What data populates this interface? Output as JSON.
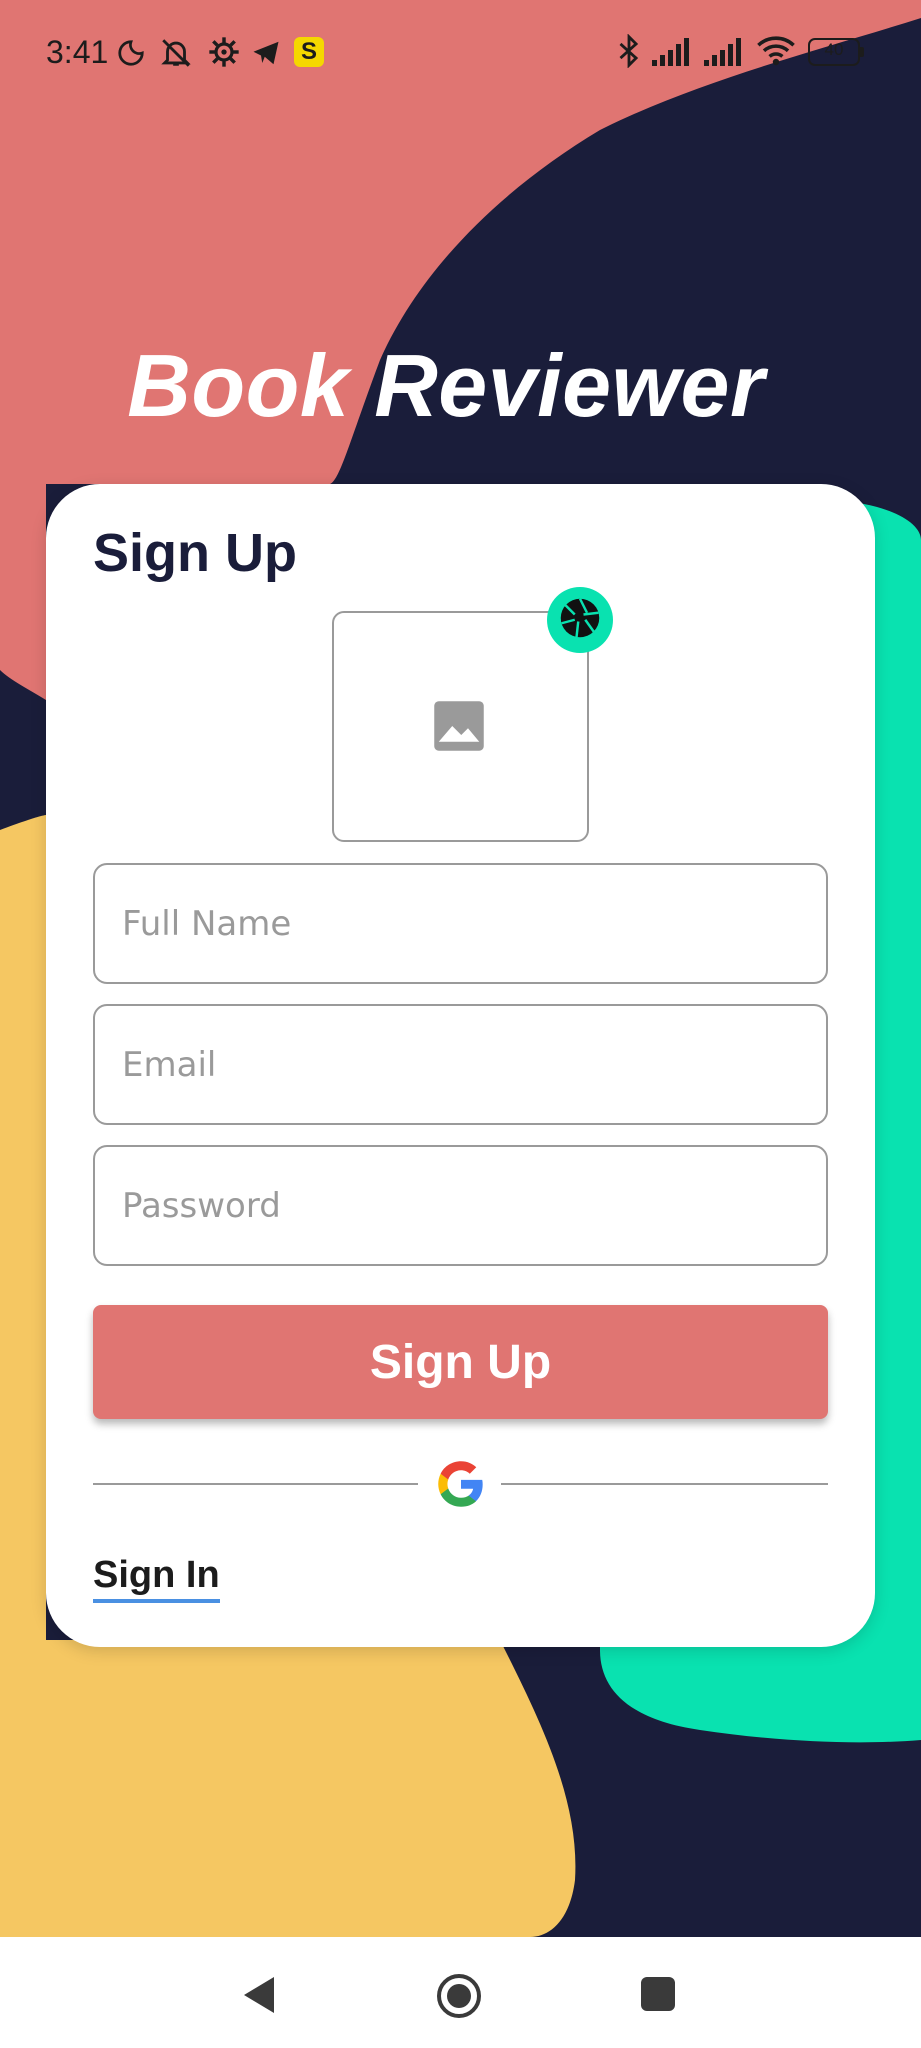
{
  "status_bar": {
    "time": "3:41",
    "battery": "40",
    "icons_left": [
      "moon-icon",
      "bell-off-icon",
      "gear-icon",
      "telegram-icon",
      "s-app-icon"
    ],
    "icons_right": [
      "bluetooth-icon",
      "signal-icon",
      "signal-icon",
      "wifi-icon",
      "battery-icon"
    ]
  },
  "app": {
    "title": "Book Reviewer"
  },
  "card": {
    "title": "Sign Up",
    "photo_icon": "image-placeholder-icon",
    "camera_icon": "camera-aperture-icon",
    "fields": {
      "full_name": {
        "placeholder": "Full Name",
        "value": ""
      },
      "email": {
        "placeholder": "Email",
        "value": ""
      },
      "password": {
        "placeholder": "Password",
        "value": ""
      }
    },
    "signup_button": "Sign Up",
    "google_icon": "google-icon",
    "signin_link": "Sign In"
  },
  "nav_bar": {
    "buttons": [
      "back-icon",
      "home-icon",
      "recents-icon"
    ]
  },
  "colors": {
    "coral": "#e07572",
    "navy": "#1a1d3a",
    "teal": "#09e2b0",
    "yellow": "#f5c762",
    "white": "#ffffff",
    "link_underline": "#4a90e2"
  }
}
